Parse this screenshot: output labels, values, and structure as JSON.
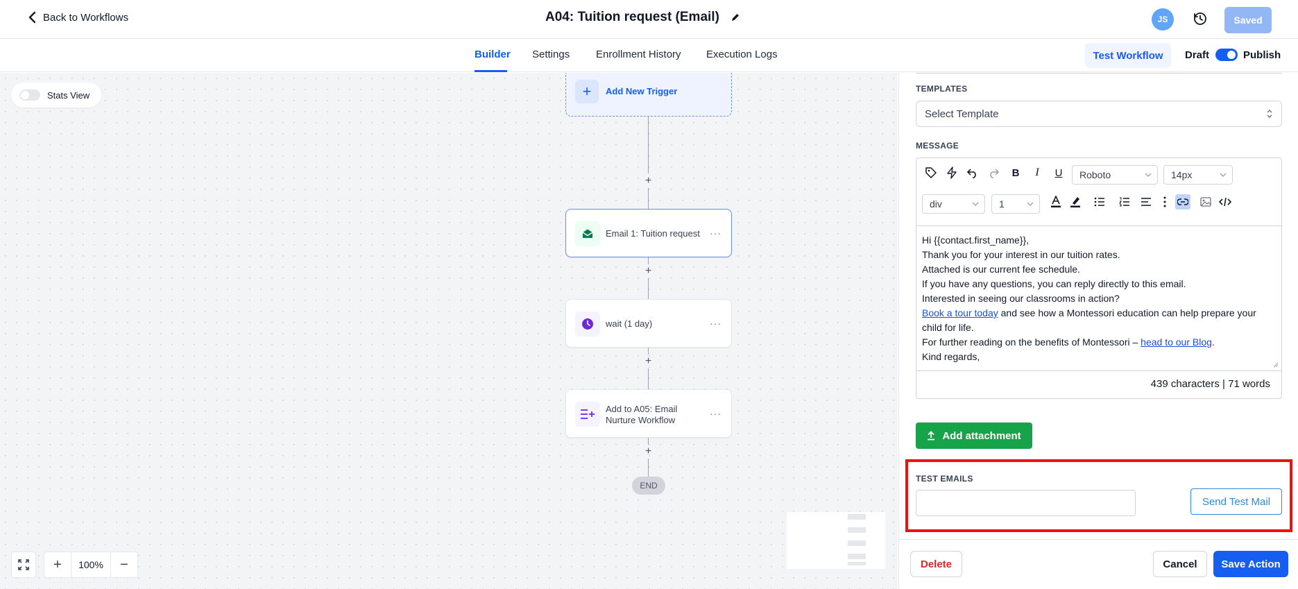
{
  "header": {
    "back_label": "Back to Workflows",
    "title": "A04: Tuition request (Email)",
    "avatar_initials": "JS",
    "saved_label": "Saved"
  },
  "tabs": [
    {
      "label": "Builder",
      "active": true
    },
    {
      "label": "Settings",
      "active": false
    },
    {
      "label": "Enrollment History",
      "active": false
    },
    {
      "label": "Execution Logs",
      "active": false
    }
  ],
  "toolbar": {
    "test_workflow_label": "Test Workflow",
    "draft_label": "Draft",
    "publish_label": "Publish",
    "publish_toggle_on": true
  },
  "canvas": {
    "stats_view_label": "Stats View",
    "add_trigger_label": "Add New Trigger",
    "nodes": [
      {
        "label": "Email 1: Tuition request",
        "icon": "email-icon",
        "color": "#047857"
      },
      {
        "label": "wait (1 day)",
        "icon": "clock-icon",
        "color": "#6d28d9"
      },
      {
        "label": "Add to A05: Email Nurture Workflow",
        "icon": "list-add-icon",
        "color": "#7c3aed"
      }
    ],
    "end_label": "END",
    "zoom_level": "100%"
  },
  "panel": {
    "templates_label": "TEMPLATES",
    "template_placeholder": "Select Template",
    "message_label": "MESSAGE",
    "font_family": "Roboto",
    "font_size": "14px",
    "block_type": "div",
    "line_height": "1",
    "message": {
      "line1": "Hi {{contact.first_name}},",
      "line2": "Thank you for your interest in our tuition rates.",
      "line3": "Attached is our current fee schedule.",
      "line4": "If you have any questions, you can reply directly to this email.",
      "line5": "Interested in seeing our classrooms in action?",
      "link1": "Book a tour today",
      "line6_rest": " and see how a Montessori education can help prepare your child for life.",
      "line7_pre": "For further reading on the benefits of Montessori – ",
      "link2": "head to our Blog",
      "line7_post": ".",
      "line8": "Kind regards,"
    },
    "counter": "439 characters | 71 words",
    "attachment_label": "Add attachment",
    "test_emails_label": "TEST EMAILS",
    "test_emails_value": "",
    "send_test_label": "Send Test Mail",
    "delete_label": "Delete",
    "cancel_label": "Cancel",
    "save_label": "Save Action"
  }
}
